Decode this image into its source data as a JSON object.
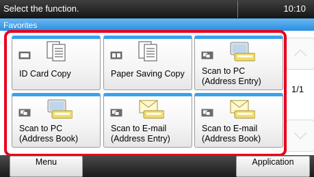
{
  "status": {
    "message": "Select the function.",
    "time": "10:10"
  },
  "section": {
    "title": "Favorites"
  },
  "tiles": [
    {
      "label": "ID Card Copy",
      "icon": "copy-documents-icon"
    },
    {
      "label": "Paper Saving Copy",
      "icon": "copy-documents-icon"
    },
    {
      "label": "Scan to PC\n(Address Entry)",
      "icon": "scan-to-pc-icon"
    },
    {
      "label": "Scan to PC\n(Address Book)",
      "icon": "scan-to-pc-icon"
    },
    {
      "label": "Scan to E-mail\n(Address Entry)",
      "icon": "scan-to-email-icon"
    },
    {
      "label": "Scan to E-mail\n(Address Book)",
      "icon": "scan-to-email-icon"
    }
  ],
  "pager": {
    "indicator": "1/1"
  },
  "bottom": {
    "menu_label": "Menu",
    "application_label": "Application"
  },
  "colors": {
    "accent_blue": "#2a8ee0",
    "highlight_red": "#e8001c",
    "status_bar": "#1a1a1a"
  }
}
